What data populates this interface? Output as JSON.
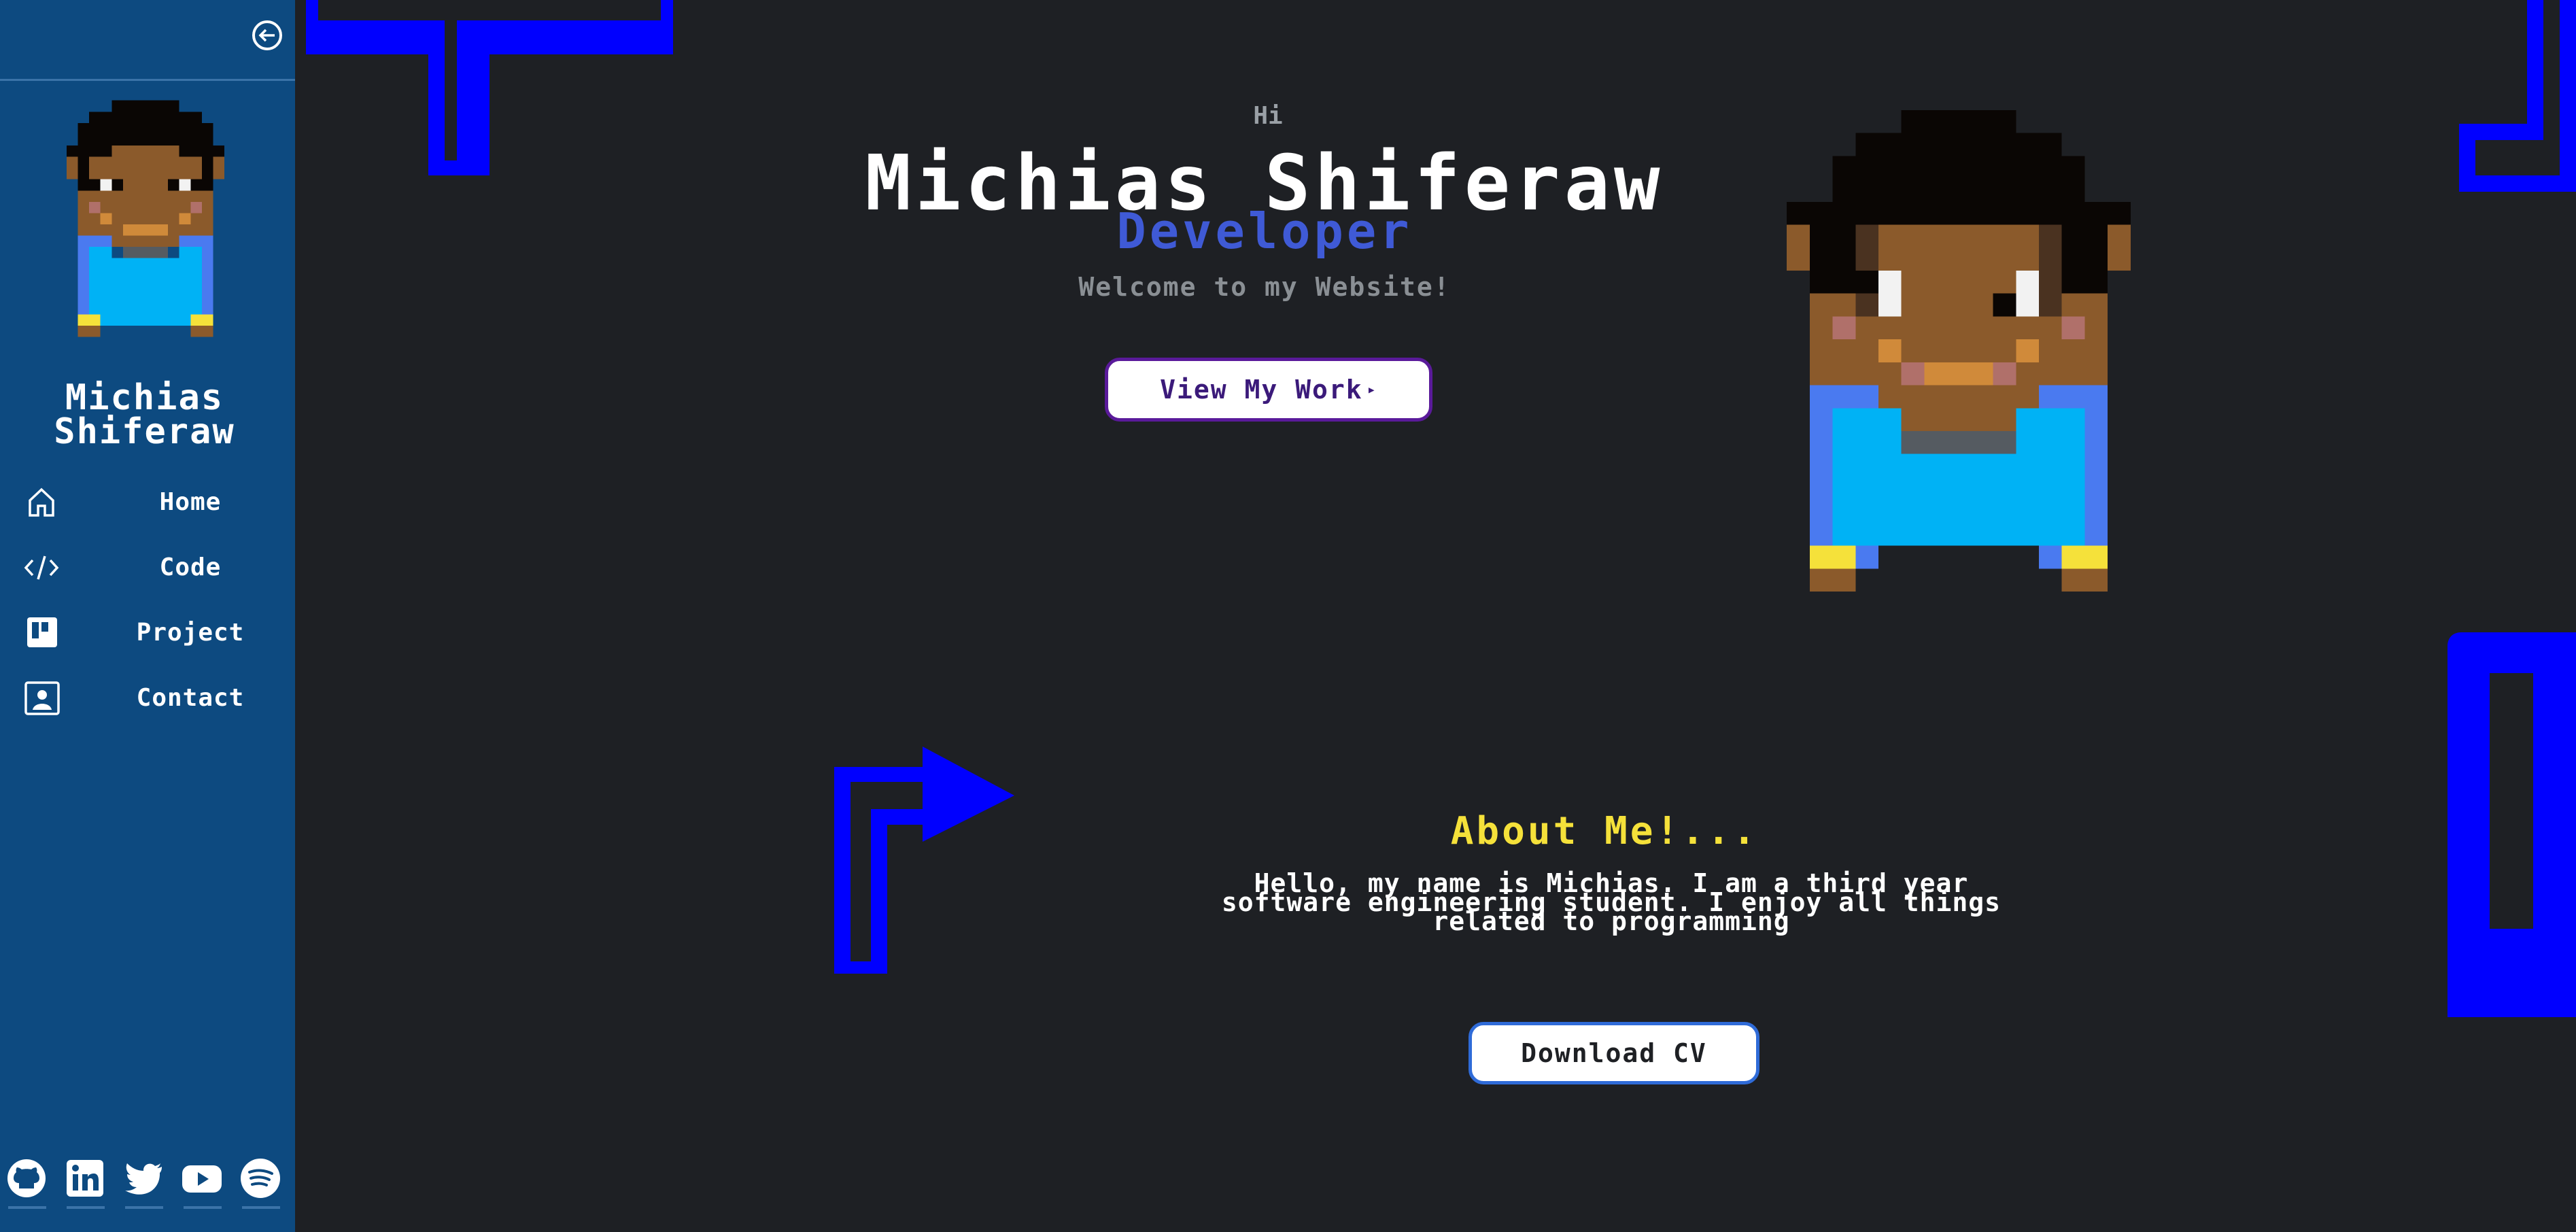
{
  "sidebar": {
    "collapse_icon": "arrow-left-circle-icon",
    "name": "Michias Shiferaw",
    "nav": [
      {
        "label": "Home",
        "icon": "home-icon"
      },
      {
        "label": "Code",
        "icon": "code-icon"
      },
      {
        "label": "Project",
        "icon": "kanban-icon"
      },
      {
        "label": "Contact",
        "icon": "person-badge-icon"
      }
    ],
    "socials": [
      "github-icon",
      "linkedin-icon",
      "twitter-icon",
      "youtube-icon",
      "spotify-icon"
    ]
  },
  "hero": {
    "greeting": "Hi",
    "name": "Michias Shiferaw",
    "role": "Developer",
    "welcome": "Welcome to my Website!",
    "cta_label": "View My Work",
    "cta_arrow": "▸"
  },
  "about": {
    "title": "About Me!...",
    "text": "Hello, my name is Michias. I am a third year software engineering student. I enjoy all things related to programming",
    "cv_label": "Download CV"
  },
  "colors": {
    "background": "#1e2024",
    "sidebar": "#0d4a80",
    "accent_blue": "#0000ff",
    "role_blue": "#3f5ad6",
    "about_yellow": "#f5e13a"
  }
}
